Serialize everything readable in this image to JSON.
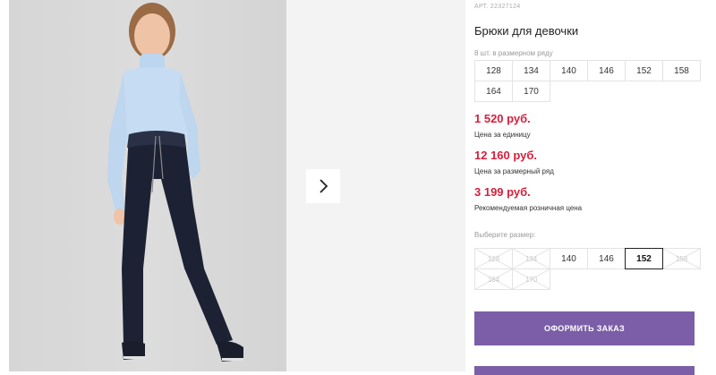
{
  "product": {
    "sku": "АРТ. 22327124",
    "title": "Брюки для девочки",
    "pack_note": "8 шт. в размерном ряду",
    "pack_sizes": [
      "128",
      "134",
      "140",
      "146",
      "152",
      "158",
      "164",
      "170"
    ]
  },
  "prices": {
    "unit_price": "1 520 руб.",
    "unit_label": "Цена за единицу",
    "pack_price": "12 160 руб.",
    "pack_label": "Цена за размерный ряд",
    "retail_price": "3 199 руб.",
    "retail_label": "Рекомендуемая розничная цена"
  },
  "size_select": {
    "label": "Выберите размер:",
    "sizes": [
      {
        "label": "128",
        "available": false,
        "selected": false
      },
      {
        "label": "134",
        "available": false,
        "selected": false
      },
      {
        "label": "140",
        "available": true,
        "selected": false
      },
      {
        "label": "146",
        "available": true,
        "selected": false
      },
      {
        "label": "152",
        "available": true,
        "selected": true
      },
      {
        "label": "158",
        "available": false,
        "selected": false
      },
      {
        "label": "164",
        "available": false,
        "selected": false
      },
      {
        "label": "170",
        "available": false,
        "selected": false
      }
    ]
  },
  "actions": {
    "order_label": "ОФОРМИТЬ ЗАКАЗ"
  },
  "icons": {
    "next": "chevron-right-icon"
  },
  "colors": {
    "price": "#d71f3b",
    "button": "#7b5ea7"
  }
}
